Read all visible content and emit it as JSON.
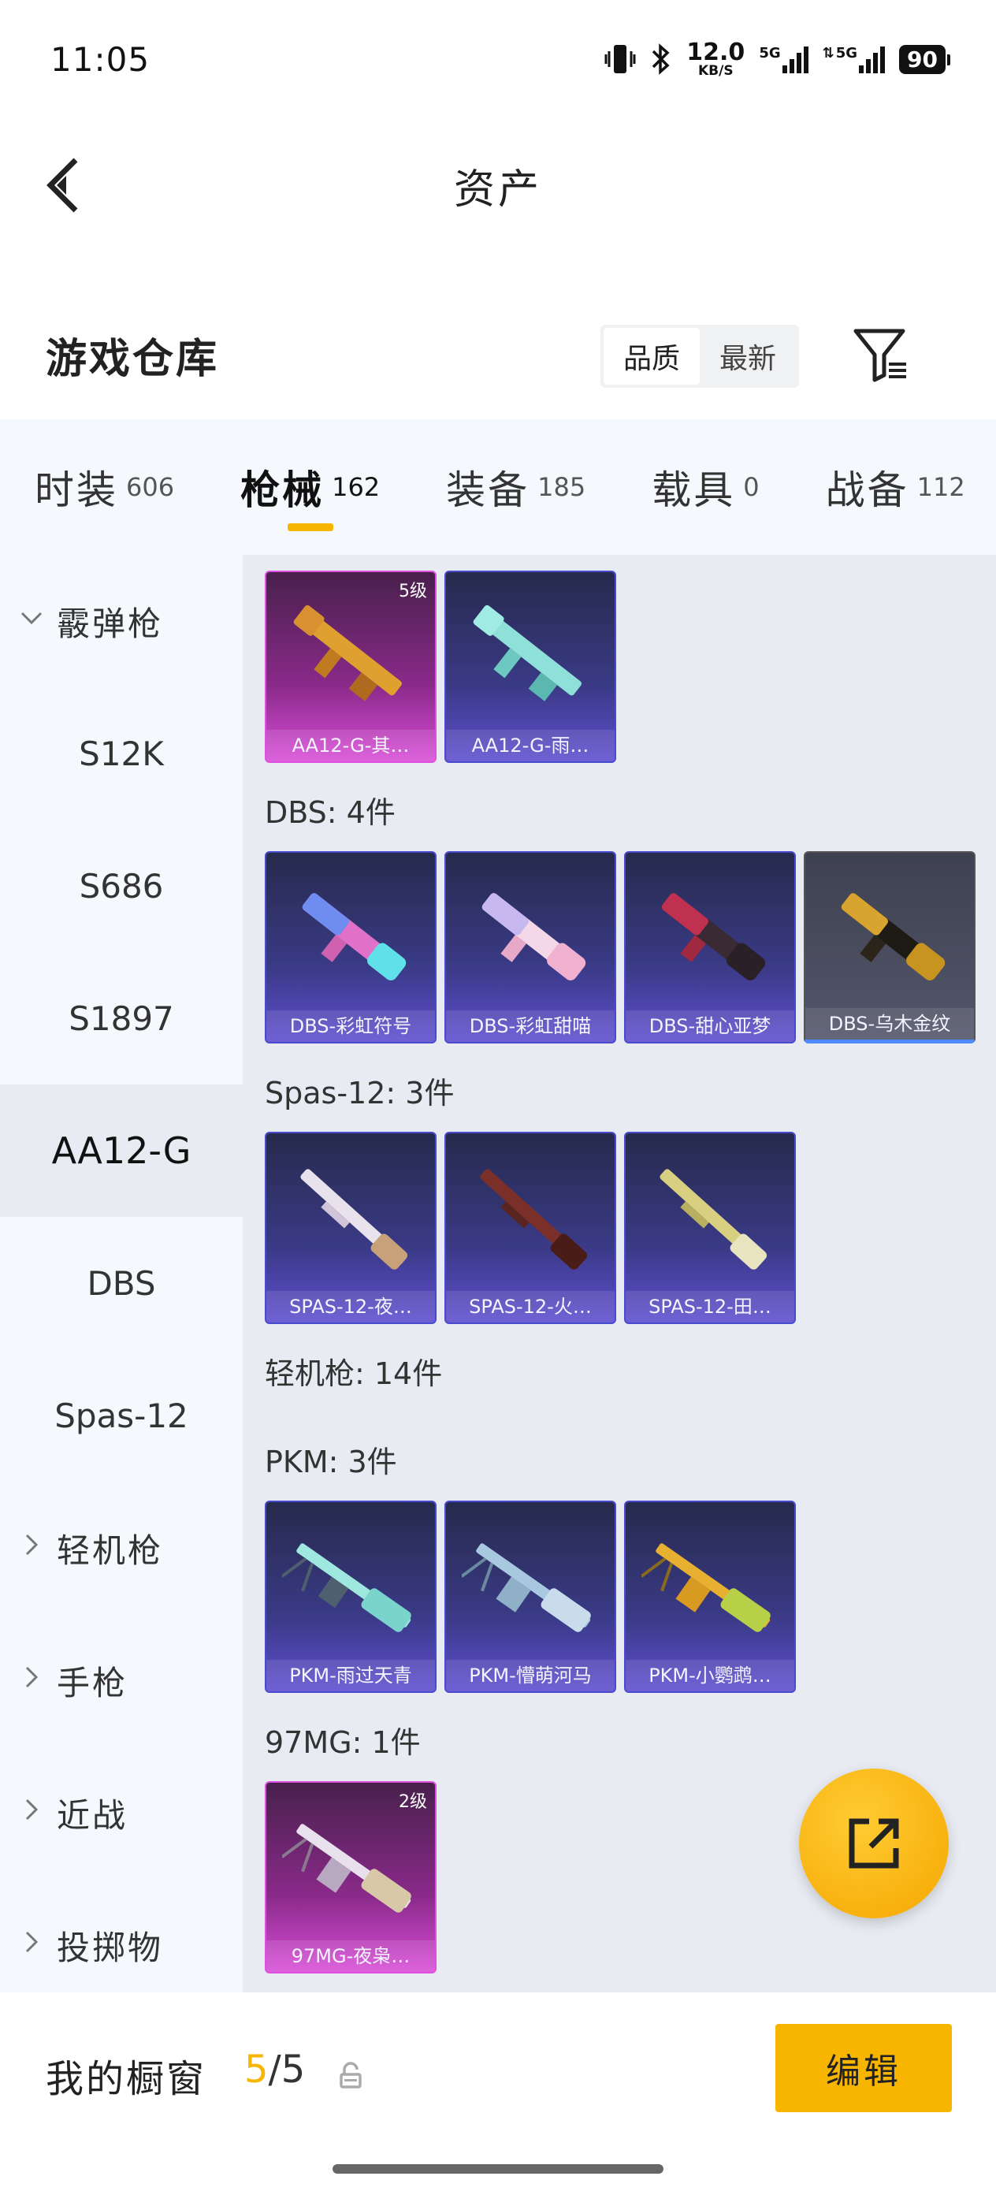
{
  "status_bar": {
    "time": "11:05",
    "net_speed_value": "12.0",
    "net_speed_unit": "KB/S",
    "sim1_label": "5G",
    "sim2_label": "5G",
    "battery": "90"
  },
  "header": {
    "title": "资产"
  },
  "section": {
    "title": "游戏仓库",
    "sort_options": [
      "品质",
      "最新"
    ],
    "active_sort": "品质"
  },
  "tabs": [
    {
      "name": "时装",
      "count": "606"
    },
    {
      "name": "枪械",
      "count": "162",
      "active": true
    },
    {
      "name": "装备",
      "count": "185"
    },
    {
      "name": "载具",
      "count": "0"
    },
    {
      "name": "战备",
      "count": "112"
    }
  ],
  "sidebar": {
    "items": [
      {
        "label": "霰弹枪",
        "type": "group",
        "expanded": true
      },
      {
        "label": "S12K",
        "type": "sub"
      },
      {
        "label": "S686",
        "type": "sub"
      },
      {
        "label": "S1897",
        "type": "sub"
      },
      {
        "label": "AA12-G",
        "type": "sub",
        "active": true
      },
      {
        "label": "DBS",
        "type": "sub"
      },
      {
        "label": "Spas-12",
        "type": "sub"
      },
      {
        "label": "轻机枪",
        "type": "group"
      },
      {
        "label": "手枪",
        "type": "group"
      },
      {
        "label": "近战",
        "type": "group"
      },
      {
        "label": "投掷物",
        "type": "group"
      }
    ]
  },
  "content": {
    "aa12": {
      "cards": [
        {
          "name": "AA12-G-其…",
          "level": "5级",
          "rarity": "purple"
        },
        {
          "name": "AA12-G-雨…",
          "rarity": "blue"
        }
      ]
    },
    "dbs": {
      "label": "DBS: 4件",
      "cards": [
        {
          "name": "DBS-彩虹符号",
          "rarity": "blue"
        },
        {
          "name": "DBS-彩虹甜喵",
          "rarity": "blue"
        },
        {
          "name": "DBS-甜心亚梦",
          "rarity": "blue"
        },
        {
          "name": "DBS-乌木金纹",
          "rarity": "gray"
        }
      ]
    },
    "spas": {
      "label": "Spas-12: 3件",
      "cards": [
        {
          "name": "SPAS-12-夜…",
          "rarity": "blue"
        },
        {
          "name": "SPAS-12-火…",
          "rarity": "blue"
        },
        {
          "name": "SPAS-12-田…",
          "rarity": "blue"
        }
      ]
    },
    "lmg": {
      "label": "轻机枪: 14件"
    },
    "pkm": {
      "label": "PKM: 3件",
      "cards": [
        {
          "name": "PKM-雨过天青",
          "rarity": "blue"
        },
        {
          "name": "PKM-懵萌河马",
          "rarity": "blue"
        },
        {
          "name": "PKM-小鹦鹉…",
          "rarity": "blue"
        }
      ]
    },
    "mg97": {
      "label": "97MG: 1件",
      "cards": [
        {
          "name": "97MG-夜枭…",
          "level": "2级",
          "rarity": "purple"
        }
      ]
    }
  },
  "bottom": {
    "showcase_label": "我的橱窗",
    "current": "5",
    "separator": "/",
    "max": "5",
    "edit_label": "编辑"
  },
  "colors": {
    "accent": "#f7b500",
    "sidebar_bg": "#f5f8fc",
    "content_bg": "#e8ecf2"
  }
}
